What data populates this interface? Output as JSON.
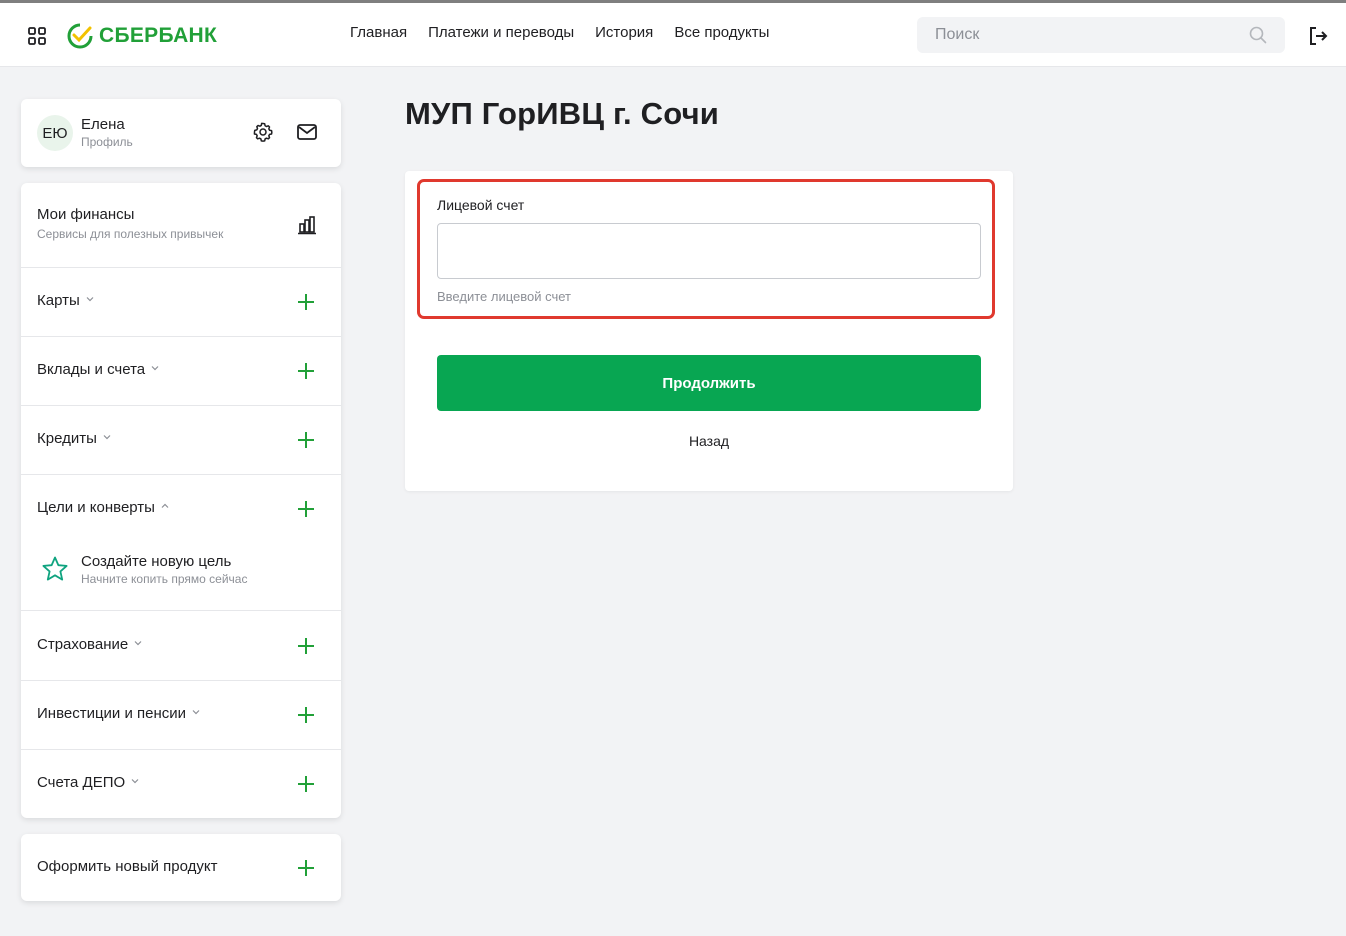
{
  "header": {
    "brand": "СБЕРБАНК",
    "nav": [
      "Главная",
      "Платежи и переводы",
      "История",
      "Все продукты"
    ],
    "search_placeholder": "Поиск",
    "icons": [
      "apps-grid-icon",
      "sber-logo-icon",
      "search-icon",
      "logout-icon"
    ]
  },
  "profile": {
    "initials": "ЕЮ",
    "name": "Елена",
    "subtitle": "Профиль"
  },
  "sidebar": {
    "finances": {
      "title": "Мои финансы",
      "subtitle": "Сервисы для полезных привычек"
    },
    "items": [
      {
        "label": "Карты",
        "state": "collapsed"
      },
      {
        "label": "Вклады и счета",
        "state": "collapsed"
      },
      {
        "label": "Кредиты",
        "state": "collapsed"
      },
      {
        "label": "Цели и конверты",
        "state": "expanded"
      },
      {
        "label": "Страхование",
        "state": "collapsed"
      },
      {
        "label": "Инвестиции и пенсии",
        "state": "collapsed"
      },
      {
        "label": "Счета ДЕПО",
        "state": "collapsed"
      }
    ],
    "goal": {
      "title": "Создайте новую цель",
      "subtitle": "Начните копить прямо сейчас"
    },
    "new_product": "Оформить новый продукт"
  },
  "main": {
    "title": "МУП ГорИВЦ г. Сочи",
    "field_label": "Лицевой счет",
    "field_value": "",
    "field_hint": "Введите лицевой счет",
    "continue_label": "Продолжить",
    "back_label": "Назад"
  },
  "colors": {
    "brand": "#21a038",
    "button": "#08a652",
    "highlight": "#e0392e",
    "background": "#f2f3f5"
  }
}
